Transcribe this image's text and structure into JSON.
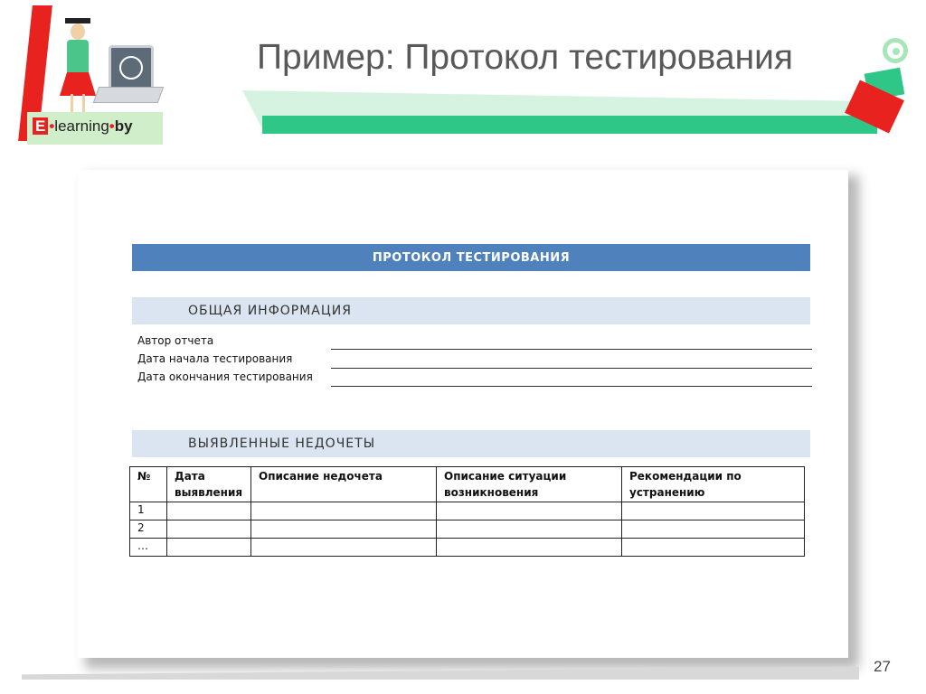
{
  "logo": {
    "e_letter": "E",
    "dot1": "•",
    "word": "learning",
    "dot2": "•",
    "suffix": "by"
  },
  "slide": {
    "title": "Пример: Протокол тестирования",
    "page_number": "27"
  },
  "document": {
    "header": "ПРОТОКОЛ ТЕСТИРОВАНИЯ",
    "general_section": "ОБЩАЯ ИНФОРМАЦИЯ",
    "fields": [
      "Автор отчета",
      "Дата начала тестирования",
      "Дата окончания тестирования"
    ],
    "defects_section": "ВЫЯВЛЕННЫЕ НЕДОЧЕТЫ",
    "table": {
      "columns": [
        "№",
        "Дата выявления",
        "Описание недочета",
        "Описание ситуации возникновения",
        "Рекомендации по устранению"
      ],
      "rows": [
        [
          "1",
          "",
          "",
          "",
          ""
        ],
        [
          "2",
          "",
          "",
          "",
          ""
        ],
        [
          "…",
          "",
          "",
          "",
          ""
        ]
      ]
    }
  },
  "colors": {
    "header_blue": "#4f81bd",
    "section_light_blue": "#dbe5f1",
    "accent_green": "#2fc788",
    "accent_red": "#e8231f"
  }
}
